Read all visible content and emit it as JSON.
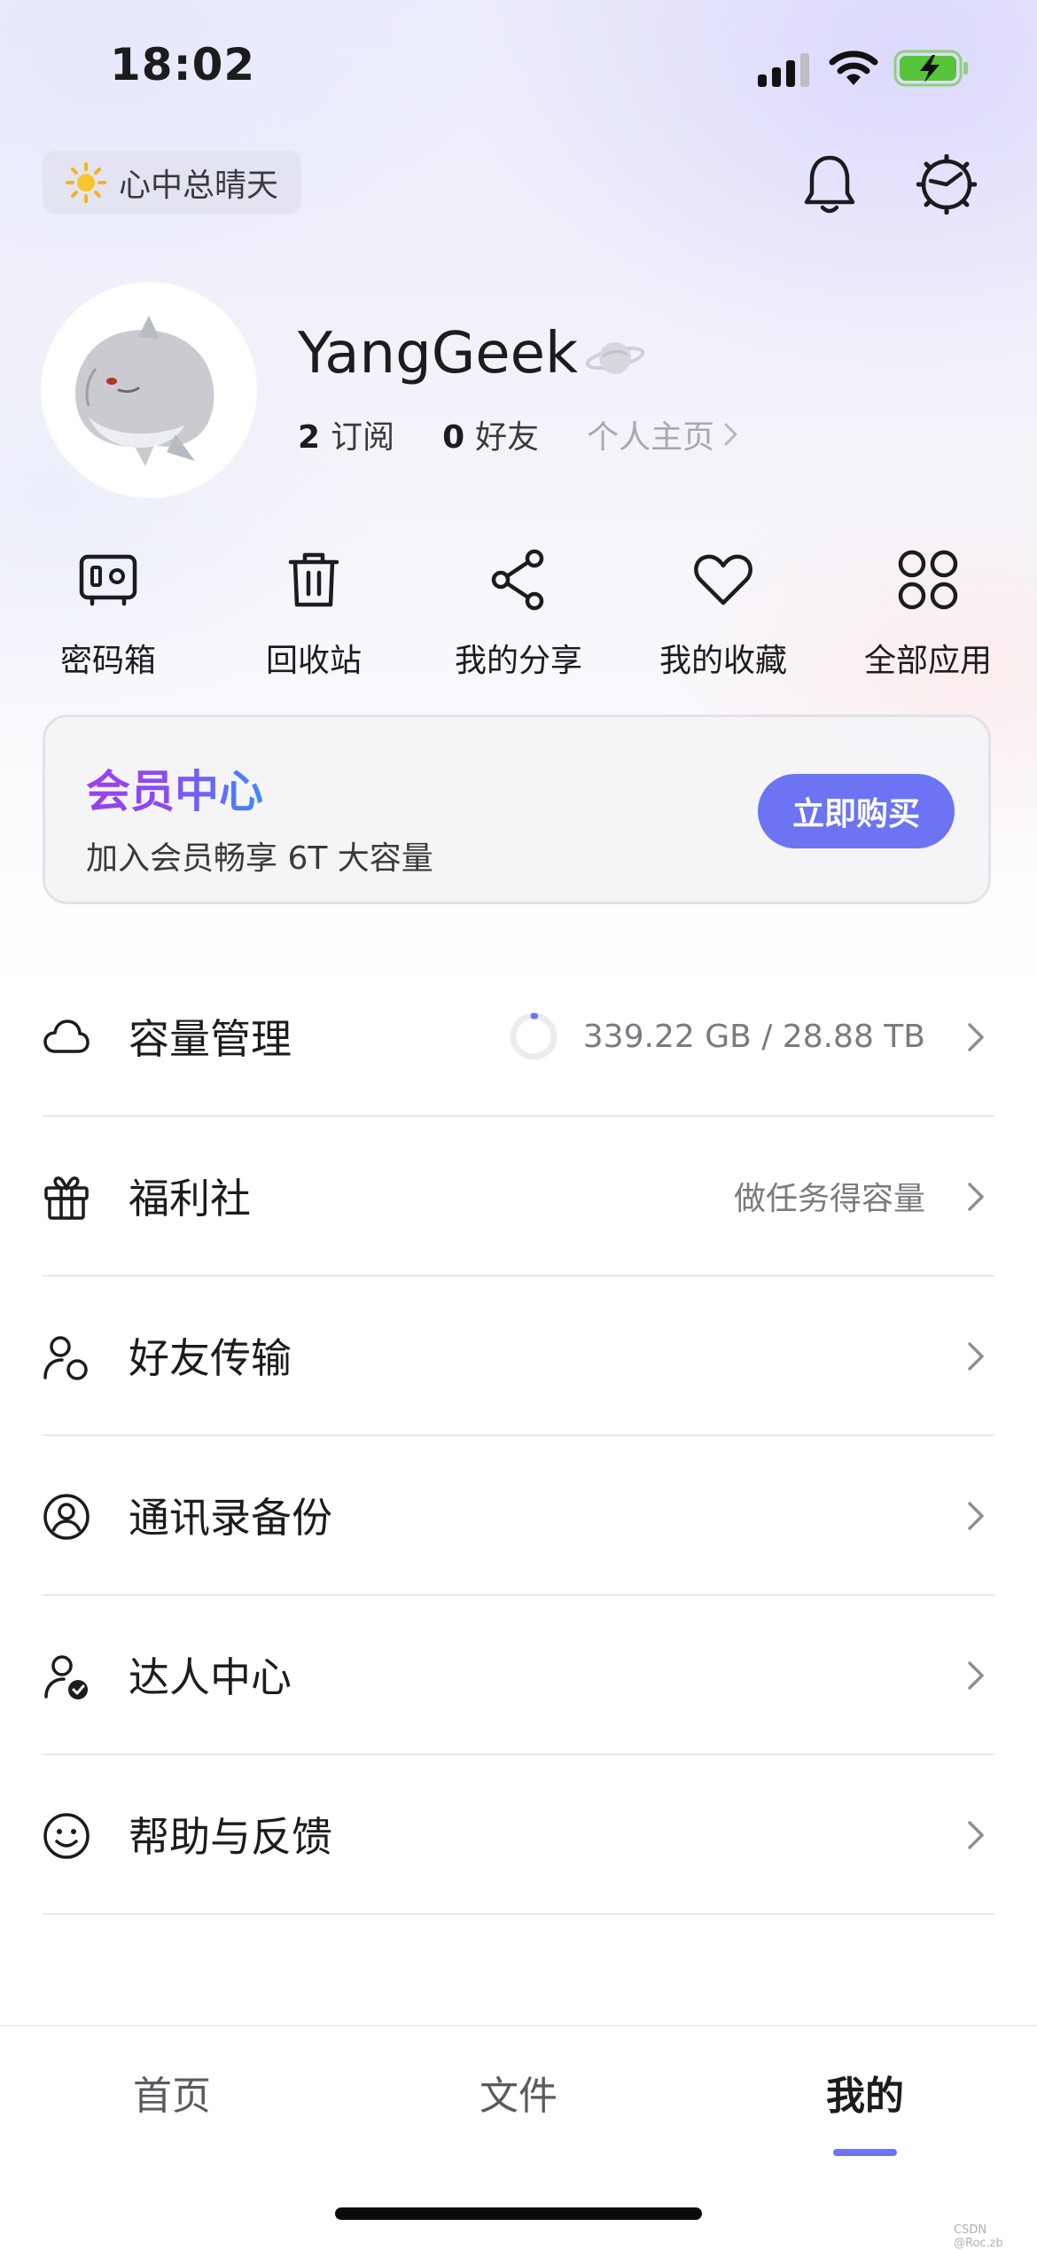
{
  "status_bar": {
    "time": "18:02",
    "battery_state": "charging"
  },
  "header": {
    "weather_text": "心中总晴天",
    "icons": [
      "sun-icon",
      "bell-icon",
      "settings-icon"
    ]
  },
  "profile": {
    "username": "YangGeek",
    "subscriptions_count": "2",
    "subscriptions_label": "订阅",
    "friends_count": "0",
    "friends_label": "好友",
    "homepage_label": "个人主页"
  },
  "quick_actions": [
    {
      "label": "密码箱",
      "icon": "safe-icon"
    },
    {
      "label": "回收站",
      "icon": "trash-icon"
    },
    {
      "label": "我的分享",
      "icon": "share-icon"
    },
    {
      "label": "我的收藏",
      "icon": "heart-icon"
    },
    {
      "label": "全部应用",
      "icon": "grid-icon"
    }
  ],
  "member_card": {
    "title": "会员中心",
    "subtitle": "加入会员畅享 6T 大容量",
    "button_label": "立即购买",
    "colors": {
      "button": "#6c74f4",
      "title_start": "#9b3ff0",
      "title_end": "#3d8cf7"
    }
  },
  "menu": [
    {
      "label": "容量管理",
      "value": "339.22 GB / 28.88 TB",
      "icon": "cloud-icon",
      "usage_fraction": 0.012
    },
    {
      "label": "福利社",
      "value": "做任务得容量",
      "icon": "gift-icon"
    },
    {
      "label": "好友传输",
      "value": "",
      "icon": "friends-transfer-icon"
    },
    {
      "label": "通讯录备份",
      "value": "",
      "icon": "contact-icon"
    },
    {
      "label": "达人中心",
      "value": "",
      "icon": "expert-icon"
    },
    {
      "label": "帮助与反馈",
      "value": "",
      "icon": "smile-icon"
    }
  ],
  "tabbar": {
    "tabs": [
      "首页",
      "文件",
      "我的"
    ],
    "active_tab": "我的",
    "accent": "#6c74f4"
  },
  "watermark": "CSDN @Roc.zb"
}
